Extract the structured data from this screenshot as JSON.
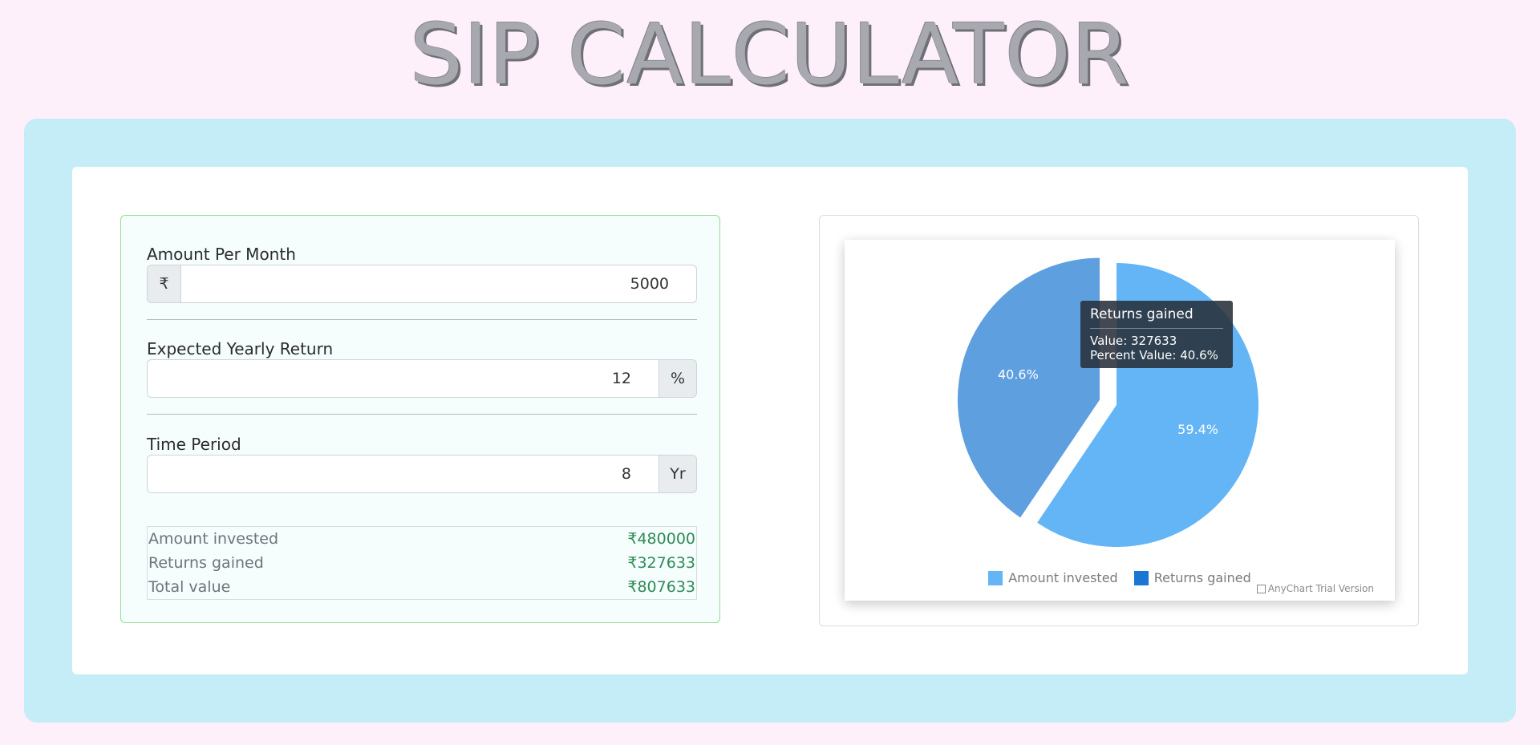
{
  "title": "SIP CALCULATOR",
  "form": {
    "amount": {
      "label": "Amount Per Month",
      "prefix": "₹",
      "value": "5000"
    },
    "return": {
      "label": "Expected Yearly Return",
      "suffix": "%",
      "value": "12"
    },
    "period": {
      "label": "Time Period",
      "suffix": "Yr",
      "value": "8"
    }
  },
  "summary": [
    {
      "label": "Amount invested",
      "value": "₹480000"
    },
    {
      "label": "Returns gained",
      "value": "₹327633"
    },
    {
      "label": "Total value",
      "value": "₹807633"
    }
  ],
  "chart_data": {
    "type": "pie",
    "categories": [
      "Amount invested",
      "Returns gained"
    ],
    "values": [
      480000,
      327633
    ],
    "data_labels": [
      "59.4%",
      "40.6%"
    ],
    "exploded": "Returns gained",
    "colors": [
      "#64b5f6",
      "#1976d2"
    ],
    "legend": "bottom",
    "tooltip": {
      "title": "Returns gained",
      "value_line": "Value: 327633",
      "percent_line": "Percent Value: 40.6%"
    },
    "credit": "AnyChart Trial Version"
  }
}
